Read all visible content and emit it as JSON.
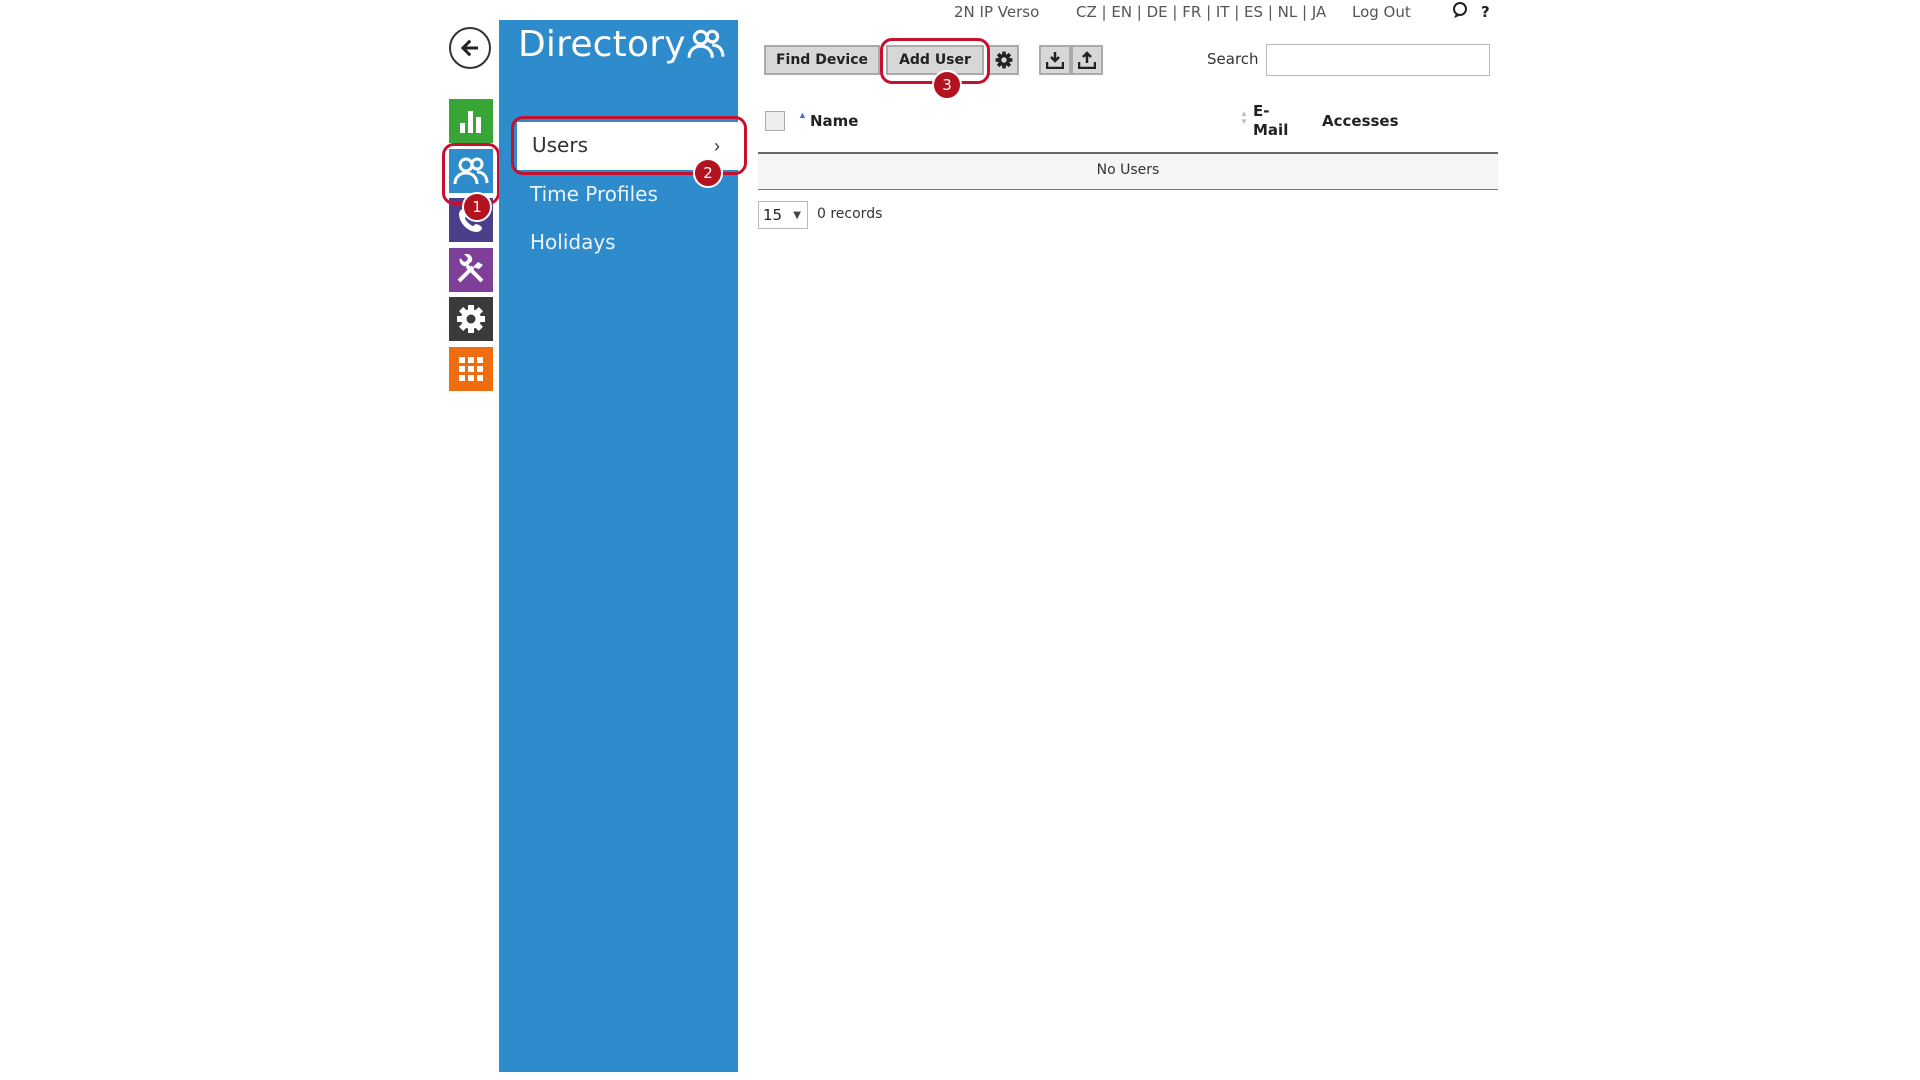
{
  "header": {
    "device_name": "2N IP Verso",
    "languages": "CZ | EN | DE | FR | IT | ES | NL | JA",
    "logout_label": "Log Out",
    "help_label": "?"
  },
  "sidebar": {
    "title": "Directory",
    "items": [
      {
        "label": "Users",
        "active": true
      },
      {
        "label": "Time Profiles",
        "active": false
      },
      {
        "label": "Holidays",
        "active": false
      }
    ]
  },
  "rail": {
    "icons": [
      {
        "name": "status-icon",
        "color": "#3aa537"
      },
      {
        "name": "directory-icon",
        "color": "#2e8bcc",
        "active": true
      },
      {
        "name": "phone-icon",
        "color": "#4b3f8c"
      },
      {
        "name": "tools-icon",
        "color": "#7e3f98"
      },
      {
        "name": "settings-icon",
        "color": "#3a3a3a"
      },
      {
        "name": "apps-icon",
        "color": "#ef6c0f"
      }
    ]
  },
  "toolbar": {
    "find_device_label": "Find Device",
    "add_user_label": "Add User",
    "search_label": "Search",
    "search_value": ""
  },
  "table": {
    "columns": [
      "Name",
      "E-Mail",
      "Accesses"
    ],
    "email_line1": "E-",
    "email_line2": "Mail",
    "empty_text": "No Users"
  },
  "pager": {
    "page_size": "15",
    "records_text": "0 records"
  },
  "annotations": [
    "1",
    "2",
    "3"
  ],
  "colors": {
    "accent_blue": "#2e8bcc",
    "annotation_red": "#c8102e"
  }
}
